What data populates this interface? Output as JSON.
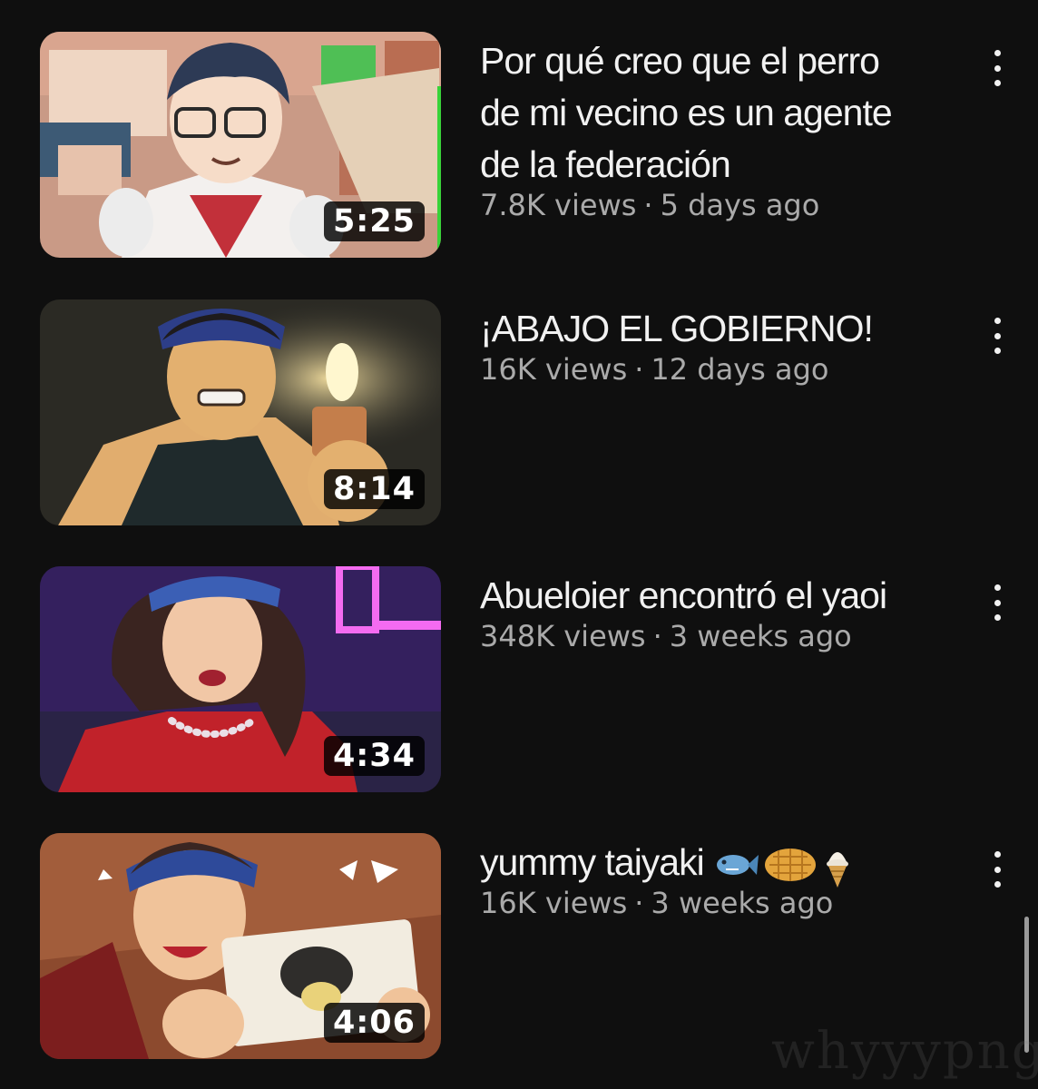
{
  "videos": [
    {
      "title": "Por qué creo que el perro\nde mi vecino es un agente\nde la federación",
      "views": "7.8K views",
      "age": "5 days ago",
      "duration": "5:25"
    },
    {
      "title": "¡ABAJO EL GOBIERNO!",
      "views": "16K views",
      "age": "12 days ago",
      "duration": "8:14"
    },
    {
      "title": "Abueloier encontró el yaoi",
      "views": "348K views",
      "age": "3 weeks ago",
      "duration": "4:34"
    },
    {
      "title": "yummy taiyaki",
      "title_emojis": [
        "fish-emoji",
        "waffle-emoji",
        "ice-cream-emoji"
      ],
      "views": "16K views",
      "age": "3 weeks ago",
      "duration": "4:06"
    }
  ],
  "separator": "·",
  "watermark": "whyyypng",
  "colors": {
    "background": "#0f0f0f",
    "title": "#f1f1f1",
    "meta": "#aaaaaa",
    "duration_bg": "#000000"
  }
}
